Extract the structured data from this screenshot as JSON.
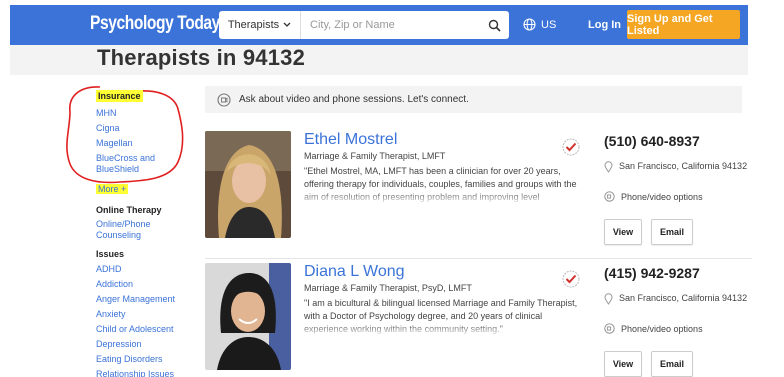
{
  "header": {
    "logo": "Psychology Today",
    "search_type": "Therapists",
    "search_placeholder": "City, Zip or Name",
    "country": "US",
    "login": "Log In",
    "signup": "Sign Up and Get Listed"
  },
  "page": {
    "title": "Therapists in 94132"
  },
  "sidebar": {
    "insurance_heading": "Insurance",
    "insurance": [
      "MHN",
      "Cigna",
      "Magellan",
      "BlueCross and BlueShield"
    ],
    "more": "More +",
    "online_heading": "Online Therapy",
    "online_link": "Online/Phone Counseling",
    "issues_heading": "Issues",
    "issues": [
      "ADHD",
      "Addiction",
      "Anger Management",
      "Anxiety",
      "Child or Adolescent",
      "Depression",
      "Eating Disorders",
      "Relationship Issues"
    ]
  },
  "banner": {
    "text": "Ask about video and phone sessions. Let's connect."
  },
  "therapists": [
    {
      "name": "Ethel Mostrel",
      "title": "Marriage & Family Therapist, LMFT",
      "quote": "\"Ethel Mostrel, MA, LMFT has been a clinician for over 20 years, offering therapy for individuals, couples, families and groups with the aim of resolution of presenting problem and improving level",
      "phone": "(510) 640-8937",
      "location": "San Francisco, California 94132",
      "phone_video": "Phone/video options",
      "view": "View",
      "email": "Email"
    },
    {
      "name": "Diana L Wong",
      "title": "Marriage & Family Therapist, PsyD, LMFT",
      "quote": "\"I am a bicultural & bilingual licensed Marriage and Family Therapist, with a Doctor of Psychology degree, and 20 years of clinical experience working within the community setting.\"",
      "phone": "(415) 942-9287",
      "location": "San Francisco, California 94132",
      "phone_video": "Phone/video options",
      "view": "View",
      "email": "Email"
    }
  ],
  "colors": {
    "brand_blue": "#3b73d8",
    "signup_orange": "#f5a623",
    "highlight": "#ffff33",
    "annotation_red": "#e02020"
  }
}
